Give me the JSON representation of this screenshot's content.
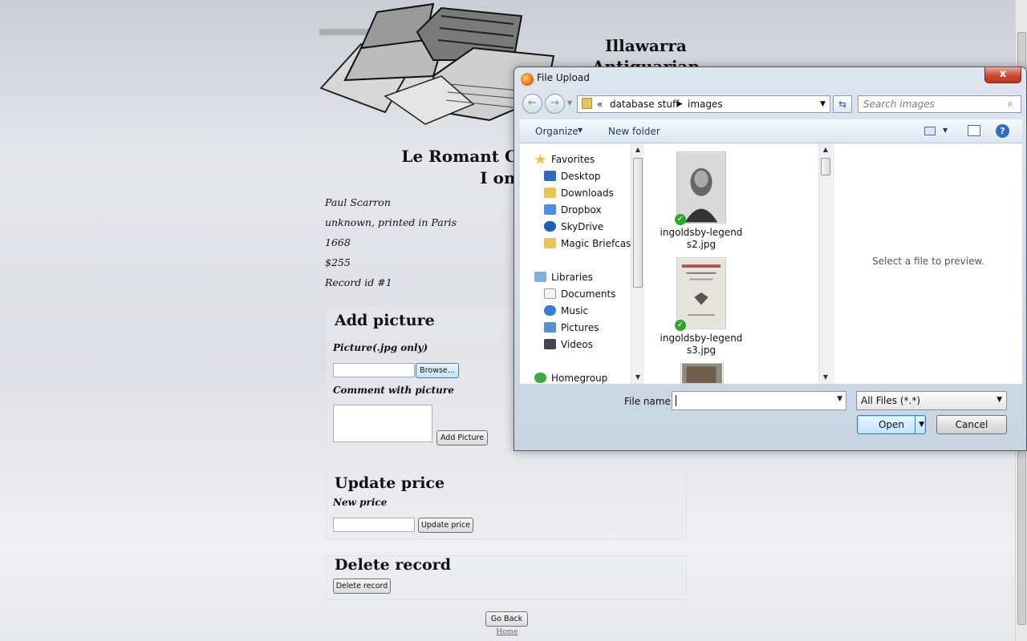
{
  "site": {
    "title": "Illawarra Antiquarian Books",
    "book_title": "Le Romant Comique (T... I only",
    "book_title_line1": "Le Romant Comique (T",
    "book_title_line2": "I only",
    "author": "Paul Scarron",
    "publisher": "unknown, printed in Paris",
    "year": "1668",
    "price": "$255",
    "record_id": "Record id #1"
  },
  "add_picture": {
    "heading": "Add picture",
    "picture_label": "Picture(.jpg only)",
    "browse_label": "Browse...",
    "comment_label": "Comment with picture",
    "submit_label": "Add Picture"
  },
  "update_price": {
    "heading": "Update price",
    "new_price_label": "New price",
    "submit_label": "Update price"
  },
  "delete_record": {
    "heading": "Delete record",
    "submit_label": "Delete record"
  },
  "footer": {
    "go_back_label": "Go Back",
    "home_label": "Home"
  },
  "dialog": {
    "title": "File Upload",
    "close_glyph": "x",
    "path_prefix": "«",
    "path": [
      "database stuff",
      "images"
    ],
    "search_placeholder": "Search images",
    "toolbar": {
      "organize": "Organize",
      "new_folder": "New folder"
    },
    "nav": {
      "favorites": "Favorites",
      "favorites_items": [
        "Desktop",
        "Downloads",
        "Dropbox",
        "SkyDrive",
        "Magic Briefcase"
      ],
      "libraries": "Libraries",
      "libraries_items": [
        "Documents",
        "Music",
        "Pictures",
        "Videos"
      ],
      "homegroup": "Homegroup"
    },
    "files": [
      {
        "name_line1": "ingoldsby-legend",
        "name_line2": "s2.jpg"
      },
      {
        "name_line1": "ingoldsby-legend",
        "name_line2": "s3.jpg"
      }
    ],
    "preview_text": "Select a file to preview.",
    "file_name_label": "File name:",
    "file_name_value": "",
    "filter_value": "All Files (*.*)",
    "open_label": "Open",
    "cancel_label": "Cancel"
  },
  "colors": {
    "dialog_frame": "#c7d4e2",
    "close_red": "#c94b35",
    "link_blue": "#1e395b"
  }
}
